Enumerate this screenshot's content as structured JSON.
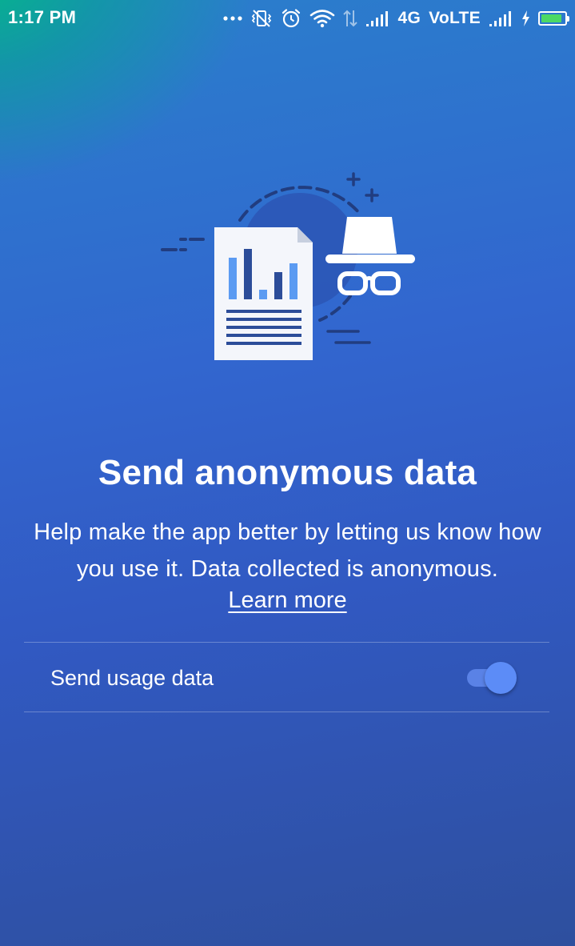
{
  "status_bar": {
    "time": "1:17 PM",
    "network": "4G",
    "volte": "VoLTE",
    "battery_level": 0.9,
    "battery_color": "#4cd964",
    "icons": [
      "more-dots-icon",
      "vibrate-icon",
      "alarm-icon",
      "wifi-icon",
      "data-transfer-icon",
      "signal-icon",
      "signal-icon",
      "charging-icon",
      "battery-icon"
    ]
  },
  "illustration": {
    "icon": "anonymous-report-illustration"
  },
  "onboarding": {
    "title": "Send anonymous data",
    "description": "Help make the app better by letting us know how you use it. Data collected is anonymous.",
    "learn_more": "Learn more"
  },
  "setting": {
    "label": "Send usage data",
    "enabled": true
  },
  "colors": {
    "gradient_top": "#00b488",
    "background": "#3266cf",
    "background_bottom": "#2e4f9e",
    "switch_thumb": "#5c8cf7",
    "switch_track": "#5a82e6"
  }
}
